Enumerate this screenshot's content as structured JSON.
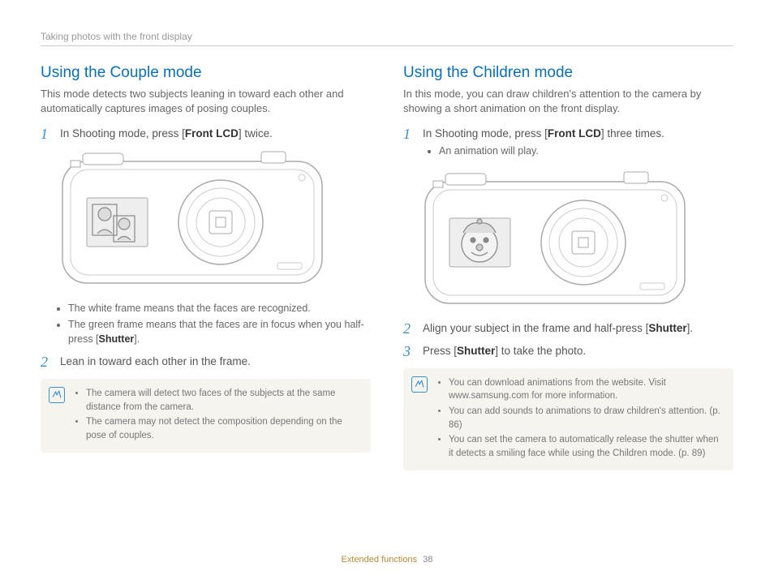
{
  "header": "Taking photos with the front display",
  "footer": {
    "section": "Extended functions",
    "page": "38"
  },
  "left": {
    "title": "Using the Couple mode",
    "intro": "This mode detects two subjects leaning in toward each other and automatically captures images of posing couples.",
    "step1_pre": "In Shooting mode, press [",
    "step1_btn": "Front LCD",
    "step1_post": "] twice.",
    "bullets": [
      "The white frame means that the faces are recognized.",
      "The green frame means that the faces are in focus when you half-press ["
    ],
    "bullet2_btn": "Shutter",
    "bullet2_post": "].",
    "step2": "Lean in toward each other in the frame.",
    "notes": [
      "The camera will detect two faces of the subjects at the same distance from the camera.",
      "The camera may not detect the composition depending on the pose of couples."
    ]
  },
  "right": {
    "title": "Using the Children mode",
    "intro": "In this mode, you can draw children's attention to the camera by showing a short animation on the front display.",
    "step1_pre": "In Shooting mode, press [",
    "step1_btn": "Front LCD",
    "step1_post": "] three times.",
    "step1_sub": "An animation will play.",
    "step2_pre": "Align your subject in the frame and half-press [",
    "step2_btn": "Shutter",
    "step2_post": "].",
    "step3_pre": "Press [",
    "step3_btn": "Shutter",
    "step3_post": "] to take the photo.",
    "notes": [
      "You can download animations from the website. Visit www.samsung.com for more information.",
      "You can add sounds to animations to draw children's attention. (p. 86)",
      "You can set the camera to automatically release the shutter when it detects a smiling face while using the Children mode. (p. 89)"
    ]
  }
}
